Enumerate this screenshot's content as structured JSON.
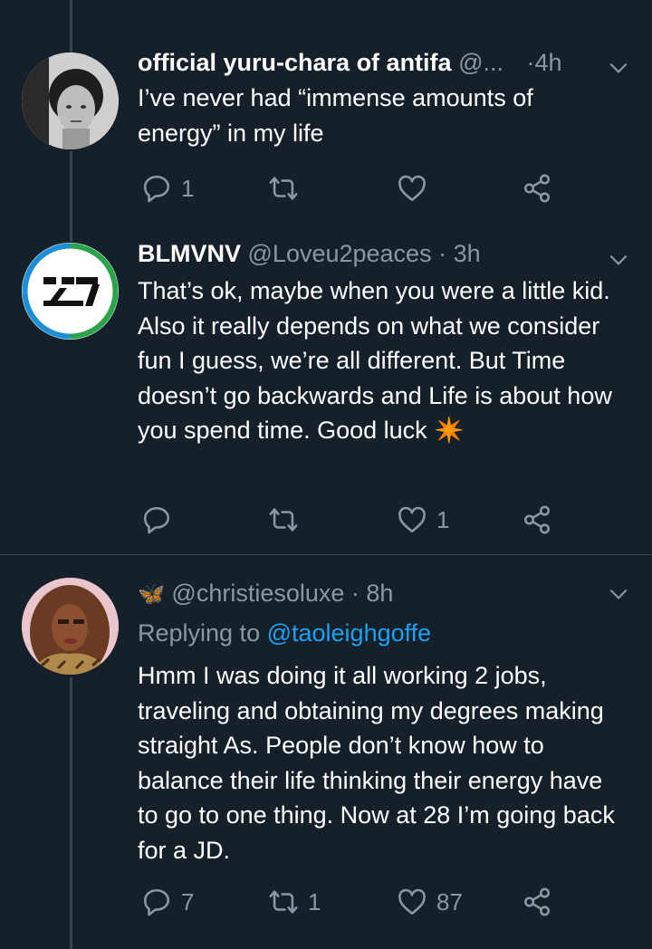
{
  "colors": {
    "background": "#15202b",
    "text": "#ffffff",
    "muted": "#8899a6",
    "link": "#1da1f2",
    "divider": "#38444d"
  },
  "tweets": [
    {
      "display_name": "official yuru-chara of antifa",
      "handle": "@...",
      "time": "·4h",
      "text": "I’ve never had “immense amounts of energy” in my life",
      "reply_count": "1",
      "retweet_count": "",
      "like_count": ""
    },
    {
      "display_name": "BLMVNV",
      "handle": "@Loveu2peaces",
      "time": "· 3h",
      "text": "That’s ok, maybe when you were a little kid. Also it really depends on what we consider fun I guess, we’re all different. But Time doesn’t go backwards and Life is about how you spend time. Good luck ✴️",
      "reply_count": "",
      "retweet_count": "",
      "like_count": "1"
    },
    {
      "display_name": "🦋",
      "handle": "@christiesoluxe",
      "time": "· 8h",
      "replying_prefix": "Replying to ",
      "replying_to": "@taoleighgoffe",
      "text": "Hmm I was doing it all working 2 jobs, traveling and obtaining my degrees making straight As. People don’t know how to balance their life thinking their energy have to go to one thing. Now at 28 I’m going back for a JD.",
      "reply_count": "7",
      "retweet_count": "1",
      "like_count": "87"
    }
  ],
  "icons": [
    "reply-icon",
    "retweet-icon",
    "like-icon",
    "share-icon",
    "chevron-down-icon"
  ]
}
